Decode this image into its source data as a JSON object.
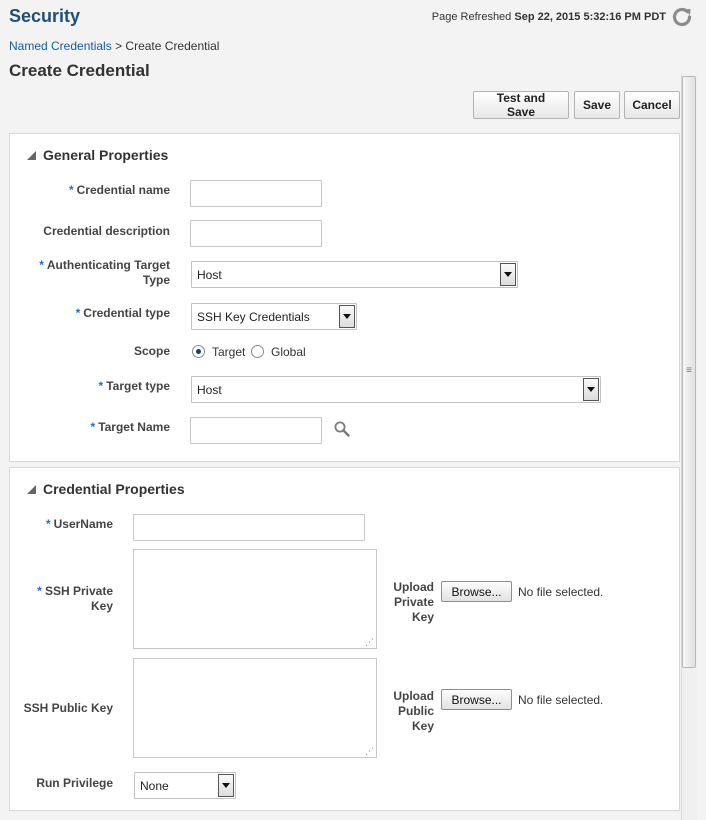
{
  "header": {
    "app_title": "Security",
    "refresh_prefix": "Page Refreshed",
    "refresh_time": "Sep 22, 2015 5:32:16 PM PDT"
  },
  "breadcrumb": {
    "parent": "Named Credentials",
    "separator": ">",
    "current": "Create Credential"
  },
  "page_title": "Create Credential",
  "toolbar": {
    "test_and_save": "Test and Save",
    "save": "Save",
    "cancel": "Cancel"
  },
  "general": {
    "title": "General Properties",
    "required_mark": "*",
    "credential_name_label": "Credential name",
    "credential_name_value": "",
    "credential_description_label": "Credential description",
    "credential_description_value": "",
    "auth_target_type_label_1": "Authenticating Target",
    "auth_target_type_label_2": "Type",
    "auth_target_type_value": "Host",
    "credential_type_label": "Credential type",
    "credential_type_value": "SSH Key Credentials",
    "scope_label": "Scope",
    "scope_options": [
      "Target",
      "Global"
    ],
    "scope_selected": "Target",
    "target_type_label": "Target type",
    "target_type_value": "Host",
    "target_name_label": "Target Name",
    "target_name_value": ""
  },
  "credential": {
    "title": "Credential Properties",
    "username_label": "UserName",
    "ssh_private_key_label_1": "SSH Private",
    "ssh_private_key_label_2": "Key",
    "ssh_public_key_label": "SSH Public Key",
    "upload_private_label": [
      "Upload",
      "Private",
      "Key"
    ],
    "upload_public_label": [
      "Upload",
      "Public",
      "Key"
    ],
    "browse_label": "Browse...",
    "no_file_text": "No file selected.",
    "run_privilege_label": "Run Privilege",
    "run_privilege_value": "None"
  },
  "colors": {
    "title": "#1f4e79",
    "link": "#145c9e",
    "required": "#1f6fc5"
  }
}
